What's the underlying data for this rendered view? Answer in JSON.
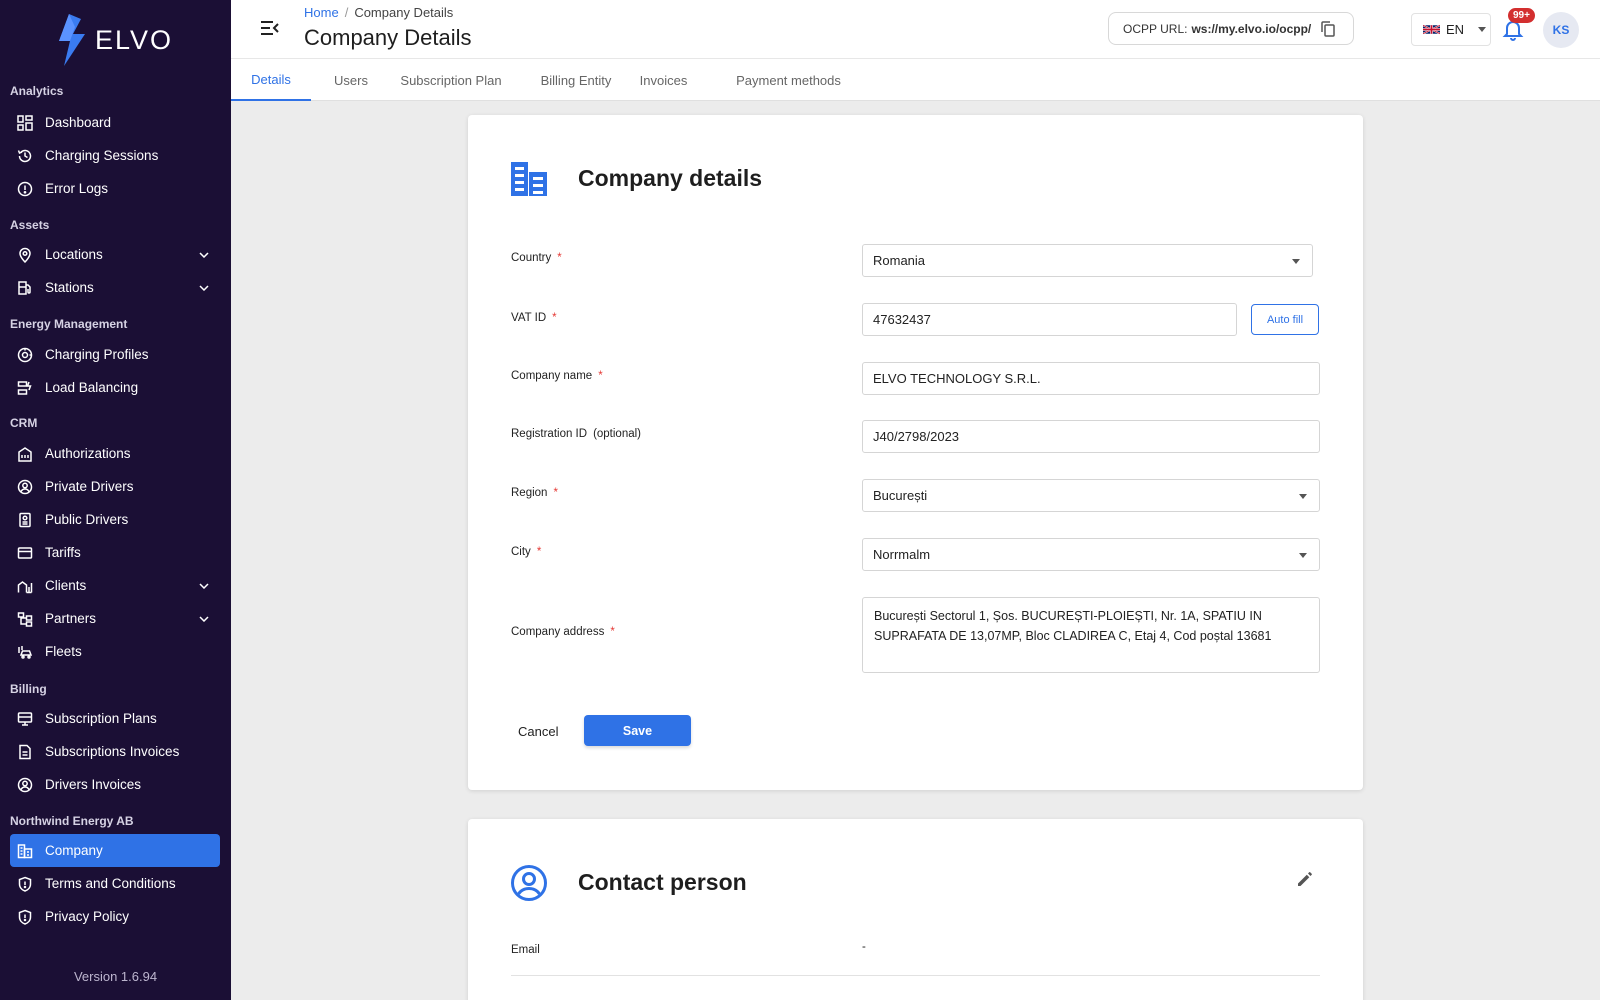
{
  "brand": {
    "name": "ELVO",
    "accent": "#2f72e6",
    "sidebar_bg": "#1b0f35"
  },
  "sidebar": {
    "sections": {
      "analytics": "Analytics",
      "assets": "Assets",
      "energy": "Energy Management",
      "crm": "CRM",
      "billing": "Billing",
      "org": "Northwind Energy AB"
    },
    "items": {
      "dashboard": "Dashboard",
      "charging_sessions": "Charging Sessions",
      "error_logs": "Error Logs",
      "locations": "Locations",
      "stations": "Stations",
      "charging_profiles": "Charging Profiles",
      "load_balancing": "Load Balancing",
      "authorizations": "Authorizations",
      "private_drivers": "Private Drivers",
      "public_drivers": "Public Drivers",
      "tariffs": "Tariffs",
      "clients": "Clients",
      "partners": "Partners",
      "fleets": "Fleets",
      "subscription_plans": "Subscription Plans",
      "subscriptions_invoices": "Subscriptions Invoices",
      "drivers_invoices": "Drivers Invoices",
      "company": "Company",
      "terms": "Terms and Conditions",
      "privacy": "Privacy Policy"
    },
    "version": "Version 1.6.94"
  },
  "header": {
    "breadcrumb_home": "Home",
    "breadcrumb_sep": "/",
    "breadcrumb_current": "Company Details",
    "title": "Company Details",
    "ocpp_label": "OCPP URL:",
    "ocpp_value": "ws://my.elvo.io/ocpp/",
    "language": "EN",
    "notifications_badge": "99+",
    "user_initials": "KS"
  },
  "tabs": [
    "Details",
    "Users",
    "Subscription Plan",
    "Billing Entity",
    "Invoices",
    "Payment methods"
  ],
  "company_card": {
    "title": "Company details",
    "country_label": "Country",
    "country_value": "Romania",
    "vat_label": "VAT ID",
    "vat_value": "47632437",
    "autofill_label": "Auto fill",
    "name_label": "Company name",
    "name_value": "ELVO TECHNOLOGY S.R.L.",
    "regid_label": "Registration ID",
    "regid_optional": "(optional)",
    "regid_value": "J40/2798/2023",
    "region_label": "Region",
    "region_value": "București",
    "city_label": "City",
    "city_value": "Norrmalm",
    "address_label": "Company address",
    "address_value": "București Sectorul 1, Șos. BUCUREȘTI-PLOIEȘTI, Nr. 1A, SPATIU IN SUPRAFATA DE 13,07MP, Bloc CLADIREA C, Etaj 4, Cod poștal 13681",
    "required_mark": "*",
    "cancel_label": "Cancel",
    "save_label": "Save"
  },
  "contact_card": {
    "title": "Contact person",
    "email_label": "Email",
    "email_value": "-"
  }
}
